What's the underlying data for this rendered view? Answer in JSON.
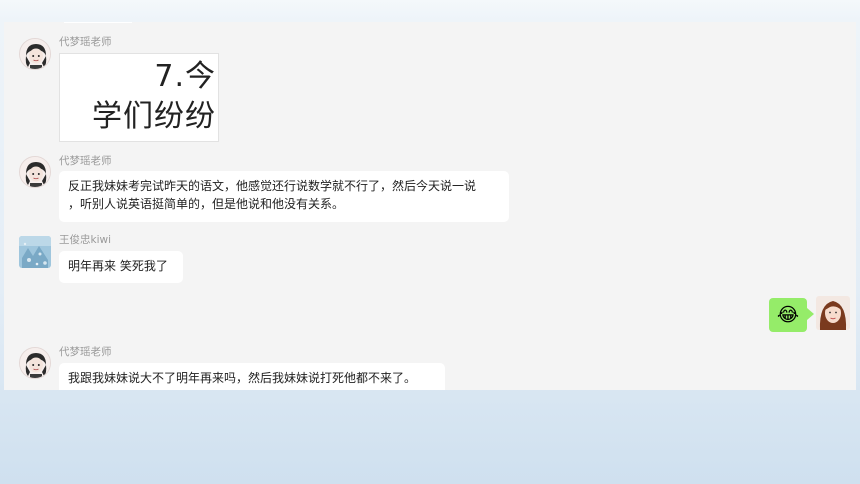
{
  "messages": [
    {
      "sender": "代梦瑶老师",
      "image_text": [
        "7.今",
        "学们纷纷"
      ]
    },
    {
      "sender": "代梦瑶老师",
      "lines": [
        "反正我妹妹考完试昨天的语文，他感觉还行说数学就不行了，然后今天说一说",
        "，听别人说英语挺简单的，但是他说和他没有关系。"
      ]
    },
    {
      "sender": "王俊忠kiwi",
      "text": "明年再来 笑死我了"
    },
    {
      "sender": "self",
      "emoji": "😂"
    },
    {
      "sender": "代梦瑶老师",
      "text": "我跟我妹妹说大不了明年再来吗，然后我妹妹说打死他都不来了。"
    }
  ],
  "colors": {
    "self_bubble": "#95ec69",
    "other_bubble": "#ffffff",
    "chat_bg": "#f4f4f4",
    "sender_name": "#9a9a9a"
  }
}
